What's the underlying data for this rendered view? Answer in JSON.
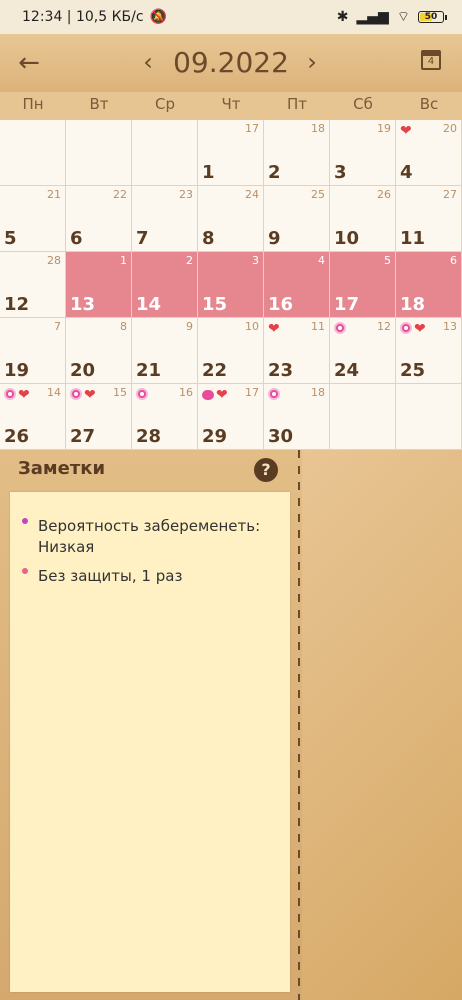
{
  "status_bar": {
    "time": "12:34 | 10,5 КБ/с",
    "battery": "50"
  },
  "header": {
    "month": "09.2022",
    "today_day": "4"
  },
  "icons": {
    "back": "arrow-left-icon",
    "prev": "chevron-left-icon",
    "next": "chevron-right-icon",
    "today": "calendar-icon",
    "help": "question-circle-icon",
    "sex": "heart-icon",
    "ovulation": "flower-icon",
    "pill": "pill-icon"
  },
  "colors": {
    "period": "#e6868f",
    "heart": "#e2434b",
    "flower": "#e84d9b",
    "note_bullet_1": "#c445c4",
    "note_bullet_2": "#e8638a"
  },
  "weekdays": [
    "Пн",
    "Вт",
    "Ср",
    "Чт",
    "Пт",
    "Сб",
    "Вс"
  ],
  "calendar": [
    {
      "day": "",
      "cycle": "",
      "period": false,
      "icons": []
    },
    {
      "day": "",
      "cycle": "",
      "period": false,
      "icons": []
    },
    {
      "day": "",
      "cycle": "",
      "period": false,
      "icons": []
    },
    {
      "day": "1",
      "cycle": "17",
      "period": false,
      "icons": []
    },
    {
      "day": "2",
      "cycle": "18",
      "period": false,
      "icons": []
    },
    {
      "day": "3",
      "cycle": "19",
      "period": false,
      "icons": []
    },
    {
      "day": "4",
      "cycle": "20",
      "period": false,
      "icons": [
        "heart"
      ]
    },
    {
      "day": "5",
      "cycle": "21",
      "period": false,
      "icons": []
    },
    {
      "day": "6",
      "cycle": "22",
      "period": false,
      "icons": []
    },
    {
      "day": "7",
      "cycle": "23",
      "period": false,
      "icons": []
    },
    {
      "day": "8",
      "cycle": "24",
      "period": false,
      "icons": []
    },
    {
      "day": "9",
      "cycle": "25",
      "period": false,
      "icons": []
    },
    {
      "day": "10",
      "cycle": "26",
      "period": false,
      "icons": []
    },
    {
      "day": "11",
      "cycle": "27",
      "period": false,
      "icons": []
    },
    {
      "day": "12",
      "cycle": "28",
      "period": false,
      "icons": []
    },
    {
      "day": "13",
      "cycle": "1",
      "period": true,
      "icons": []
    },
    {
      "day": "14",
      "cycle": "2",
      "period": true,
      "icons": []
    },
    {
      "day": "15",
      "cycle": "3",
      "period": true,
      "icons": []
    },
    {
      "day": "16",
      "cycle": "4",
      "period": true,
      "icons": []
    },
    {
      "day": "17",
      "cycle": "5",
      "period": true,
      "icons": []
    },
    {
      "day": "18",
      "cycle": "6",
      "period": true,
      "icons": []
    },
    {
      "day": "19",
      "cycle": "7",
      "period": false,
      "icons": []
    },
    {
      "day": "20",
      "cycle": "8",
      "period": false,
      "icons": []
    },
    {
      "day": "21",
      "cycle": "9",
      "period": false,
      "icons": []
    },
    {
      "day": "22",
      "cycle": "10",
      "period": false,
      "icons": []
    },
    {
      "day": "23",
      "cycle": "11",
      "period": false,
      "icons": [
        "heart"
      ]
    },
    {
      "day": "24",
      "cycle": "12",
      "period": false,
      "icons": [
        "flower"
      ]
    },
    {
      "day": "25",
      "cycle": "13",
      "period": false,
      "icons": [
        "flower",
        "heart"
      ]
    },
    {
      "day": "26",
      "cycle": "14",
      "period": false,
      "icons": [
        "flower",
        "heart"
      ]
    },
    {
      "day": "27",
      "cycle": "15",
      "period": false,
      "icons": [
        "flower",
        "heart"
      ]
    },
    {
      "day": "28",
      "cycle": "16",
      "period": false,
      "icons": [
        "flower"
      ]
    },
    {
      "day": "29",
      "cycle": "17",
      "period": false,
      "icons": [
        "pill",
        "heart"
      ]
    },
    {
      "day": "30",
      "cycle": "18",
      "period": false,
      "icons": [
        "flower"
      ]
    },
    {
      "day": "",
      "cycle": "",
      "period": false,
      "icons": []
    },
    {
      "day": "",
      "cycle": "",
      "period": false,
      "icons": []
    }
  ],
  "notes": {
    "title": "Заметки",
    "items": [
      "Вероятность забеременеть: Низкая",
      "Без защиты, 1 раз"
    ]
  }
}
